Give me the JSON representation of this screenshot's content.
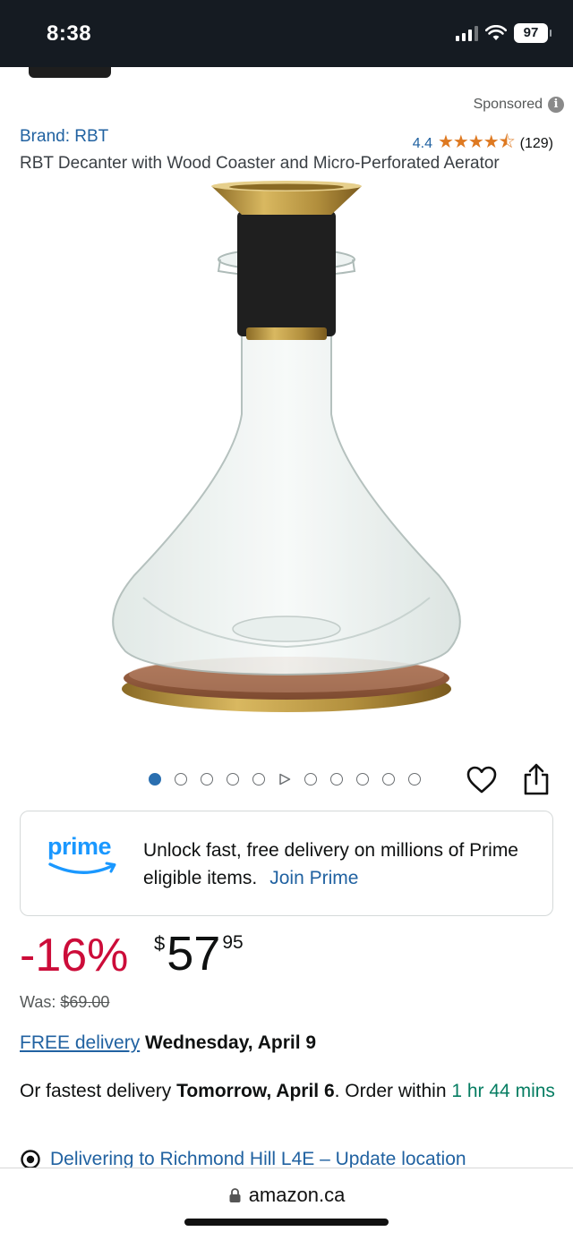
{
  "status_bar": {
    "time": "8:38",
    "battery": "97"
  },
  "sponsored": {
    "label": "Sponsored",
    "info_glyph": "i"
  },
  "product": {
    "brand": "Brand: RBT",
    "rating": "4.4",
    "stars": "★★★★⯪",
    "rating_count": "(129)",
    "title": "RBT Decanter with Wood Coaster and Micro-Perforated Aerator"
  },
  "carousel": {
    "dot_count": 11,
    "active_index": 0,
    "video_index": 5
  },
  "prime": {
    "logo_text": "prime",
    "message": "Unlock fast, free delivery on millions of Prime eligible items.",
    "link": "Join Prime"
  },
  "price": {
    "discount": "-16%",
    "currency": "$",
    "whole": "57",
    "fraction": "95",
    "was_label": "Was:",
    "was_value": "$69.00"
  },
  "delivery": {
    "free_link": "FREE delivery",
    "free_date": "Wednesday, April 9",
    "fastest_prefix": "Or fastest delivery",
    "fastest_date": "Tomorrow, April 6",
    "order_within": ". Order within",
    "countdown": "1 hr 44 mins"
  },
  "location": {
    "text": "Delivering to Richmond Hill L4E – Update location"
  },
  "browser": {
    "url": "amazon.ca"
  },
  "colors": {
    "link": "#2162a1",
    "discount": "#cc0c39",
    "prime": "#1a98ff",
    "star": "#de7921",
    "green": "#067d62"
  }
}
